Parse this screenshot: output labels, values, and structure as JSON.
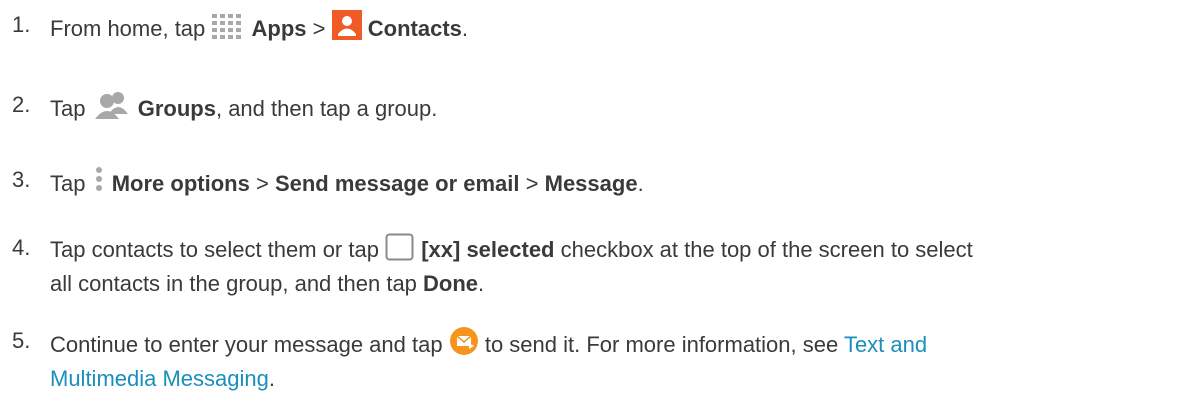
{
  "steps": [
    {
      "number": "1.",
      "t1": "From home, tap",
      "apps_label": "Apps",
      "sep": ">",
      "contacts_label": "Contacts",
      "end": "."
    },
    {
      "number": "2.",
      "t1": "Tap",
      "groups_label": "Groups",
      "t2": ", and then tap a group."
    },
    {
      "number": "3.",
      "t1": "Tap",
      "more_label": "More options",
      "sep1": ">",
      "send_label": "Send message or email",
      "sep2": ">",
      "message_label": "Message",
      "end": "."
    },
    {
      "number": "4.",
      "t1": "Tap contacts to select them or tap",
      "selected_label": "[xx] selected",
      "t2": "checkbox at the top of the screen to select",
      "line2": "all contacts in the group, and then tap",
      "done_label": "Done",
      "end": "."
    },
    {
      "number": "5.",
      "t1": "Continue to enter your message and tap",
      "t2": "to send it. For more information, see",
      "link1": "Text and",
      "link2": "Multimedia Messaging",
      "end": "."
    }
  ],
  "icons": {
    "apps": "apps-grid-icon",
    "contacts": "contacts-icon",
    "groups": "groups-icon",
    "more": "more-options-icon",
    "checkbox": "checkbox-icon",
    "send": "send-message-icon"
  },
  "colors": {
    "text": "#3a3a3a",
    "link": "#1a8fbd",
    "contacts_icon": "#f05a24",
    "send_icon": "#f7941d",
    "icon_gray": "#a8a8a8"
  }
}
